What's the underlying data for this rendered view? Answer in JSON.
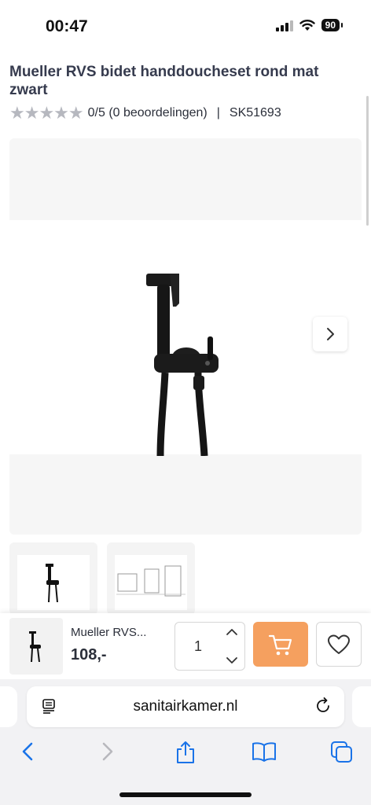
{
  "status_bar": {
    "time": "00:47",
    "battery": "90"
  },
  "product": {
    "title": "Mueller RVS bidet handdoucheset rond mat zwart",
    "rating_text": "0/5 (0 beoordelingen)",
    "separator": "|",
    "sku": "SK51693",
    "stars_filled": 0,
    "stars_total": 5
  },
  "gallery": {
    "next_icon": "chevron-right-icon",
    "thumbnails": [
      "product-photo",
      "technical-drawing"
    ]
  },
  "purchase_bar": {
    "name": "Mueller RVS...",
    "price": "108,-",
    "quantity": "1",
    "cart_color": "#f5a05f"
  },
  "browser": {
    "url": "sanitairkamer.nl",
    "toolbar_icons": [
      "back-icon",
      "forward-icon",
      "share-icon",
      "bookmarks-icon",
      "tabs-icon"
    ],
    "accent": "#1a73e8"
  }
}
